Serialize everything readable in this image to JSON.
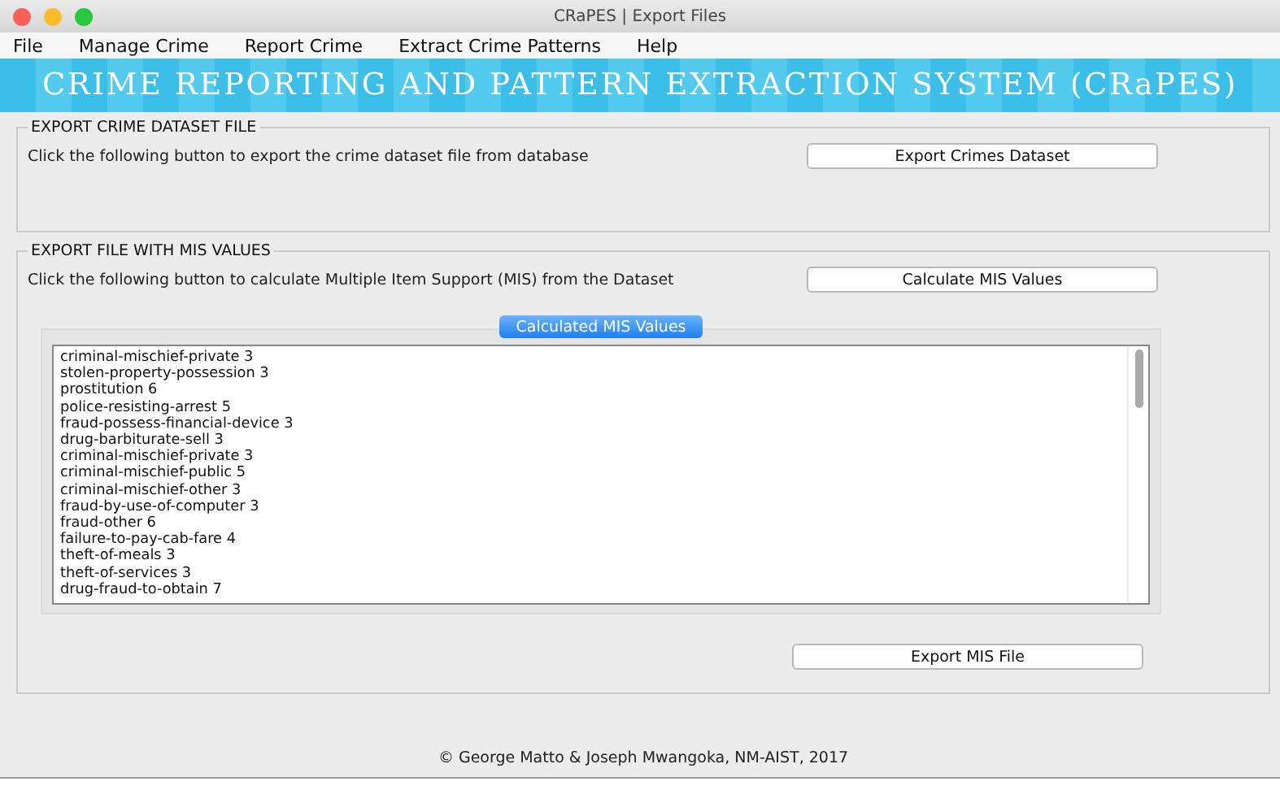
{
  "window": {
    "title": "CRaPES | Export Files"
  },
  "menu": [
    "File",
    "Manage Crime",
    "Report Crime",
    "Extract Crime Patterns",
    "Help"
  ],
  "banner": "CRIME REPORTING AND PATTERN EXTRACTION SYSTEM (CRaPES)",
  "export_dataset": {
    "title": "EXPORT CRIME DATASET FILE",
    "text": "Click the following button to export the crime dataset file from database",
    "button": "Export Crimes Dataset"
  },
  "export_mis": {
    "title": "EXPORT FILE WITH MIS VALUES",
    "text": "Click the following button to calculate  Multiple Item Support (MIS) from the Dataset",
    "button": "Calculate MIS Values",
    "tab": {
      "label": "Calculated MIS Values",
      "selected": true
    },
    "lines": [
      "criminal-mischief-private 3",
      "stolen-property-possession 3",
      "prostitution 6",
      "police-resisting-arrest 5",
      "fraud-possess-financial-device 3",
      "drug-barbiturate-sell 3",
      "criminal-mischief-private 3",
      "criminal-mischief-public 5",
      "criminal-mischief-other 3",
      "fraud-by-use-of-computer 3",
      "fraud-other 6",
      "failure-to-pay-cab-fare 4",
      "theft-of-meals 3",
      "theft-of-services 3",
      "drug-fraud-to-obtain 7"
    ],
    "export_button": "Export MIS File"
  },
  "footer": "© George Matto & Joseph Mwangoka, NM-AIST, 2017"
}
